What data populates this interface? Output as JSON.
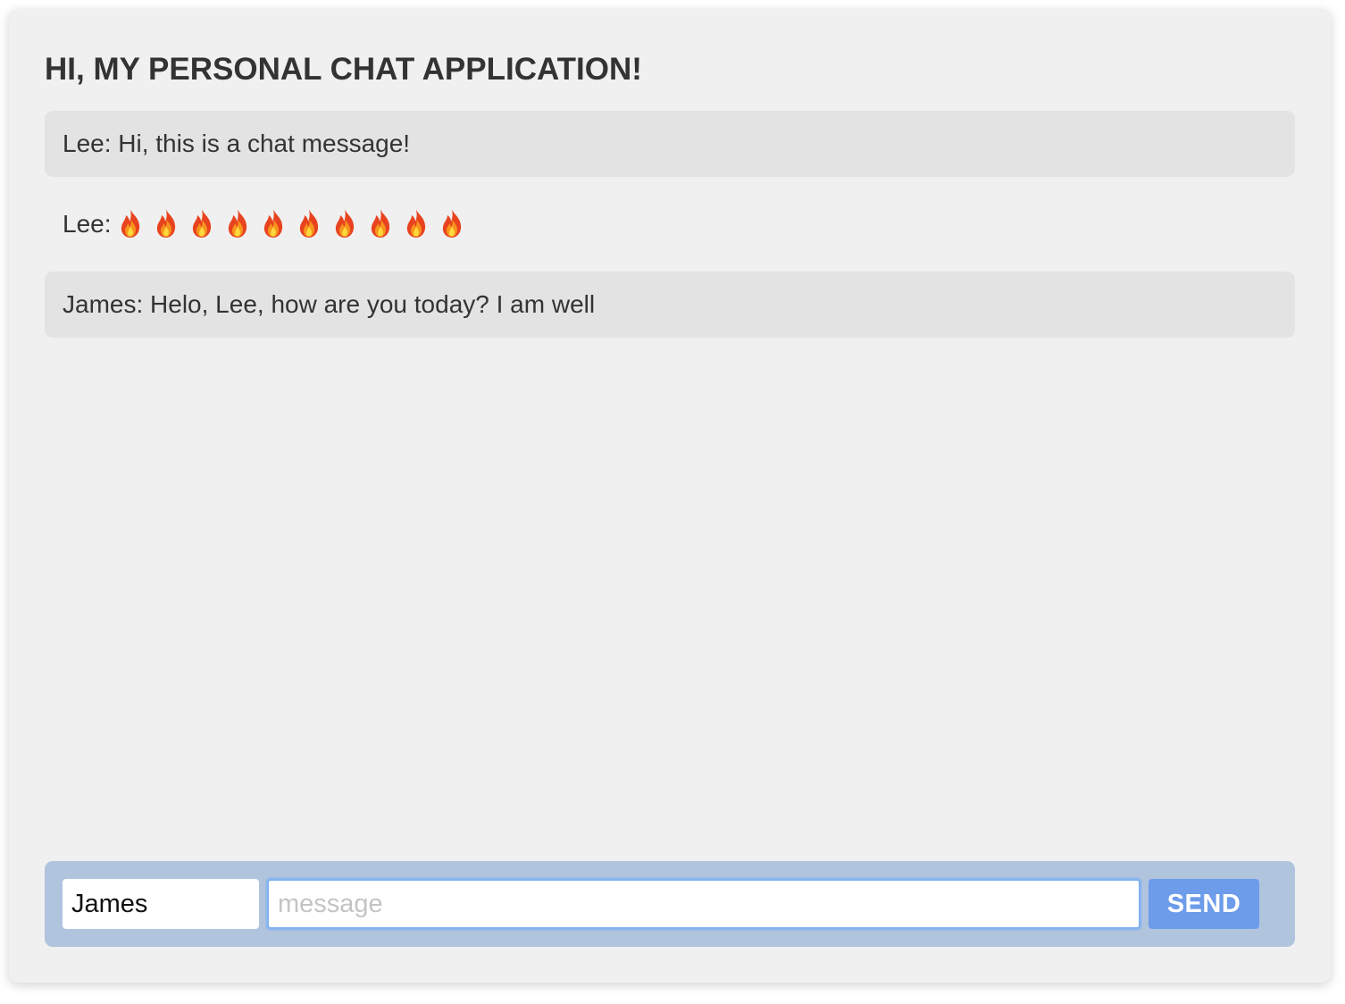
{
  "header": {
    "title": "HI, MY PERSONAL CHAT APPLICATION!"
  },
  "messages": [
    {
      "author": "Lee",
      "separator": ": ",
      "text": "Hi, this is a chat message!"
    },
    {
      "author": "Lee",
      "separator": ": ",
      "text": "",
      "emoji_icon": "fire-icon",
      "emoji_count": 10
    },
    {
      "author": "James",
      "separator": ": ",
      "text": "Helo, Lee, how are you today? I am well"
    }
  ],
  "composer": {
    "name_value": "James",
    "message_value": "",
    "message_placeholder": "message",
    "send_label": "SEND"
  },
  "colors": {
    "panel_background": "#f0f0f0",
    "message_highlight": "#e3e3e3",
    "composer_background": "#b0c4de",
    "send_button": "#6c9cea",
    "focus_ring": "#7eb1f2",
    "title_text": "#333333"
  }
}
